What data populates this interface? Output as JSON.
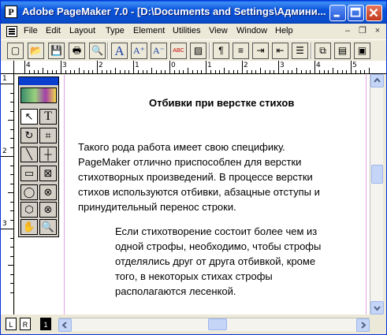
{
  "window": {
    "title": "Adobe PageMaker 7.0 - [D:\\Documents and Settings\\Админи...",
    "app_icon": "P",
    "controls": {
      "minimize_icon": "minimize-icon",
      "maximize_icon": "maximize-icon",
      "close_icon": "close-icon"
    }
  },
  "menubar": {
    "items": [
      "File",
      "Edit",
      "Layout",
      "Type",
      "Element",
      "Utilities",
      "View",
      "Window",
      "Help"
    ],
    "mdi": {
      "minimize": "–",
      "restore": "❐",
      "close": "×"
    }
  },
  "toolbar": {
    "buttons": [
      {
        "name": "new-icon",
        "glyph": "▢"
      },
      {
        "name": "open-icon",
        "glyph": "📂"
      },
      {
        "name": "save-icon",
        "glyph": "💾"
      },
      {
        "name": "print-icon",
        "glyph": "🖶"
      },
      {
        "name": "find-icon",
        "glyph": "🔍"
      },
      {
        "name": "font-icon",
        "glyph": "A"
      },
      {
        "name": "font-larger-icon",
        "glyph": "A⁺"
      },
      {
        "name": "font-smaller-icon",
        "glyph": "A⁻"
      },
      {
        "name": "spelling-icon",
        "glyph": "ABC"
      },
      {
        "name": "fill-icon",
        "glyph": "▨"
      },
      {
        "name": "paragraph-icon",
        "glyph": "¶"
      },
      {
        "name": "align-icon",
        "glyph": "≡"
      },
      {
        "name": "indent-icon",
        "glyph": "⇥"
      },
      {
        "name": "outdent-icon",
        "glyph": "⇤"
      },
      {
        "name": "bullets-icon",
        "glyph": "☰"
      },
      {
        "name": "copy-icon",
        "glyph": "⧉"
      },
      {
        "name": "paste-icon",
        "glyph": "▤"
      },
      {
        "name": "more-icon",
        "glyph": "▣"
      }
    ]
  },
  "rulers": {
    "top_labels": [
      "4",
      "3",
      "2",
      "1",
      "0",
      "1",
      "2",
      "3",
      "4",
      "5",
      "6"
    ],
    "left_labels": [
      "1",
      "2",
      "3"
    ]
  },
  "document": {
    "heading": "Отбивки при верстке стихов",
    "paragraph1": [
      "Такого рода работа имеет свою специфику.",
      "PageMaker отлично приспособлен для верстки",
      "стихотворных произведений. В процессе верстки",
      "стихов используются отбивки, абзацные отступы и",
      "принудительный перенос строки."
    ],
    "paragraph2": [
      "Если стихотворение состоит более чем из",
      "одной строфы, необходимо, чтобы строфы",
      "отделялись друг от друга отбивкой, кроме",
      "того, в некоторых стихах строфы",
      "располагаются лесенкой."
    ]
  },
  "toolbox": {
    "tools": [
      {
        "name": "pointer-tool",
        "glyph": "↖"
      },
      {
        "name": "text-tool",
        "glyph": "T"
      },
      {
        "name": "rotate-tool",
        "glyph": "↻"
      },
      {
        "name": "crop-tool",
        "glyph": "⌗"
      },
      {
        "name": "line-tool",
        "glyph": "╲"
      },
      {
        "name": "constrained-line-tool",
        "glyph": "┼"
      },
      {
        "name": "rectangle-tool",
        "glyph": "▭"
      },
      {
        "name": "rectangle-frame-tool",
        "glyph": "⊠"
      },
      {
        "name": "ellipse-tool",
        "glyph": "◯"
      },
      {
        "name": "ellipse-frame-tool",
        "glyph": "⊗"
      },
      {
        "name": "polygon-tool",
        "glyph": "⬡"
      },
      {
        "name": "polygon-frame-tool",
        "glyph": "⊗"
      },
      {
        "name": "hand-tool",
        "glyph": "✋"
      },
      {
        "name": "zoom-tool",
        "glyph": "🔍"
      }
    ]
  },
  "pages": {
    "left_master": "L",
    "right_master": "R",
    "current_page": "1"
  }
}
